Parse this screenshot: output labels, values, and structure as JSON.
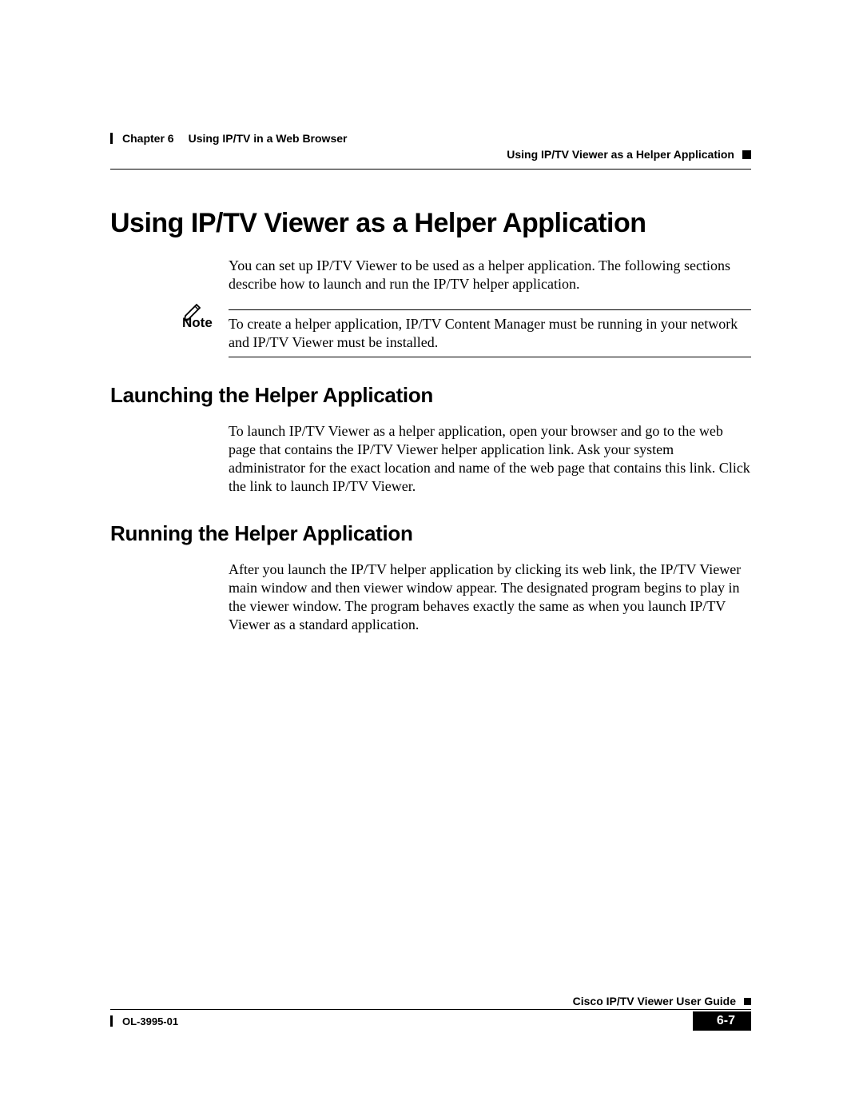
{
  "header": {
    "chapter": "Chapter 6",
    "chapter_title": "Using IP/TV in a Web Browser",
    "section_title": "Using IP/TV Viewer as a Helper Application"
  },
  "content": {
    "h1": "Using IP/TV Viewer as a Helper Application",
    "intro": "You can set up IP/TV Viewer to be used as a helper application. The following sections describe how to launch and run the IP/TV helper application.",
    "note_label": "Note",
    "note_text": "To create a helper application, IP/TV Content Manager must be running in your network and IP/TV Viewer must be installed.",
    "h2a": "Launching the Helper Application",
    "p_launch": "To launch IP/TV Viewer as a helper application, open your browser and go to the web page that contains the IP/TV Viewer helper application link. Ask your system administrator for the exact location and name of the web page that contains this link. Click the link to launch IP/TV Viewer.",
    "h2b": "Running the Helper Application",
    "p_run": "After you launch the IP/TV helper application by clicking its web link, the IP/TV Viewer main window and then viewer window appear. The designated program begins to play in the viewer window. The program behaves exactly the same as when you launch IP/TV Viewer as a standard application."
  },
  "footer": {
    "guide": "Cisco IP/TV Viewer User Guide",
    "doc_id": "OL-3995-01",
    "page_num": "6-7"
  }
}
